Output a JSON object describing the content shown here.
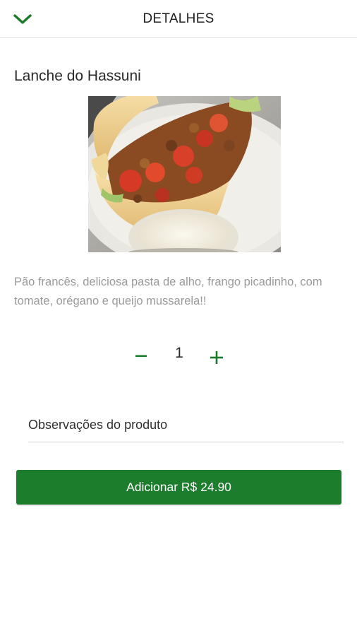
{
  "header": {
    "title": "DETALHES",
    "back_icon": "chevron-down-icon"
  },
  "product": {
    "name": "Lanche do Hassuni",
    "image_icon": "sandwich-photo",
    "description": "Pão francês, deliciosa pasta de alho, frango picadinho, com tomate, orégano e queijo mussarela!!"
  },
  "quantity": {
    "minus": "−",
    "value": "1",
    "plus": "+"
  },
  "notes": {
    "placeholder": "Observações do produto",
    "value": ""
  },
  "add_button": {
    "label": "Adicionar R$ 24.90"
  },
  "colors": {
    "accent": "#1c7d2c",
    "chevron": "#1b7a2b",
    "description_text": "#9a9a9a"
  }
}
